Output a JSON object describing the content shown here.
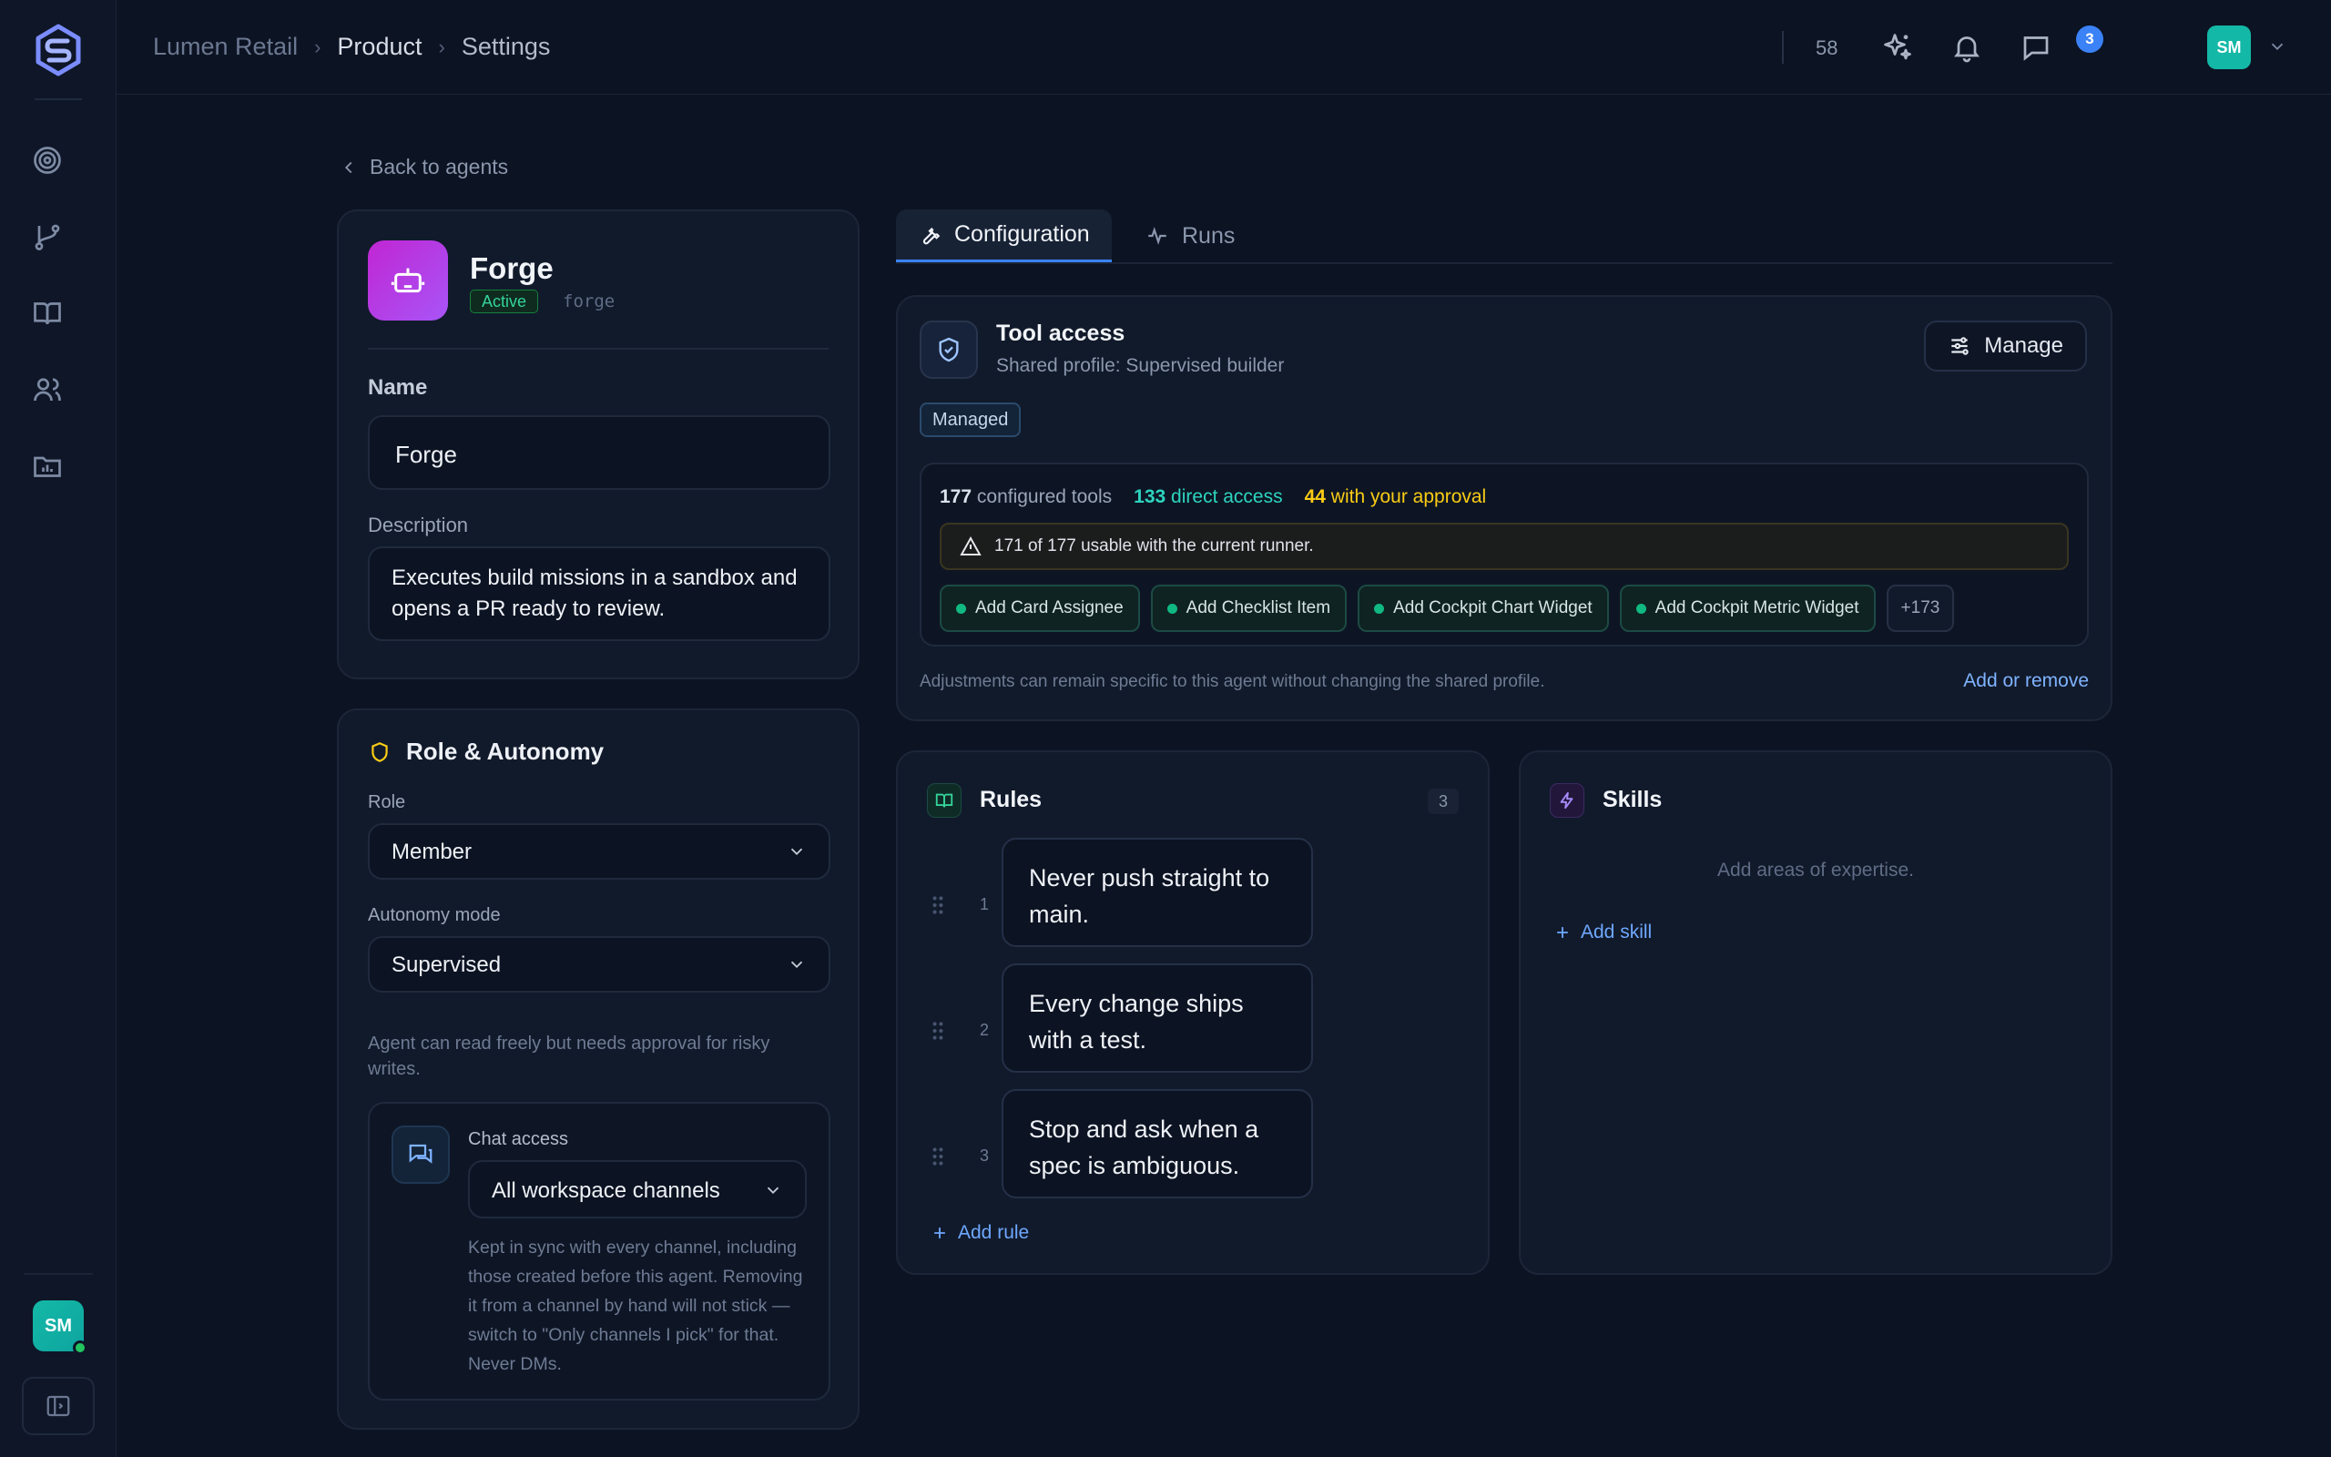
{
  "breadcrumb": [
    "Lumen Retail",
    "Product",
    "Settings"
  ],
  "topbar": {
    "count": "58",
    "notifications": "3",
    "user_initials": "SM"
  },
  "rail": {
    "user_initials": "SM"
  },
  "back_label": "Back to agents",
  "agent": {
    "name": "Forge",
    "status": "Active",
    "handle": "forge",
    "name_label": "Name",
    "name_value": "Forge",
    "description_label": "Description",
    "description_value": "Executes build missions in a sandbox and opens a PR ready to review."
  },
  "role": {
    "title": "Role & Autonomy",
    "role_label": "Role",
    "role_value": "Member",
    "autonomy_label": "Autonomy mode",
    "autonomy_value": "Supervised",
    "autonomy_hint": "Agent can read freely but needs approval for risky writes.",
    "chat_label": "Chat access",
    "chat_value": "All workspace channels",
    "chat_hint": "Kept in sync with every channel, including those created before this agent. Removing it from a channel by hand will not stick — switch to \"Only channels I pick\" for that. Never DMs."
  },
  "tabs": [
    {
      "label": "Configuration",
      "icon": "wrench-icon",
      "active": true
    },
    {
      "label": "Runs",
      "icon": "activity-icon",
      "active": false
    }
  ],
  "tool_access": {
    "title": "Tool access",
    "subtitle": "Shared profile: Supervised builder",
    "manage_label": "Manage",
    "badge": "Managed",
    "configured_count": "177",
    "configured_label": "configured tools",
    "direct_count": "133",
    "direct_label": "direct access",
    "approval_count": "44",
    "approval_label": "with your approval",
    "warning": "171 of 177 usable with the current runner.",
    "tools": [
      "Add Card Assignee",
      "Add Checklist Item",
      "Add Cockpit Chart Widget",
      "Add Cockpit Metric Widget"
    ],
    "more": "+173",
    "footer": "Adjustments can remain specific to this agent without changing the shared profile.",
    "add_remove_label": "Add or remove"
  },
  "rules": {
    "title": "Rules",
    "count": "3",
    "items": [
      {
        "num": "1",
        "text": "Never push straight to main."
      },
      {
        "num": "2",
        "text": "Every change ships with a test."
      },
      {
        "num": "3",
        "text": "Stop and ask when a spec is ambiguous."
      }
    ],
    "add_label": "Add rule"
  },
  "skills": {
    "title": "Skills",
    "empty": "Add areas of expertise.",
    "add_label": "Add skill"
  },
  "colors": {
    "accent": "#3b82f6",
    "success": "#10b981",
    "warning": "#facc15",
    "agent_avatar": "#a855f7"
  }
}
